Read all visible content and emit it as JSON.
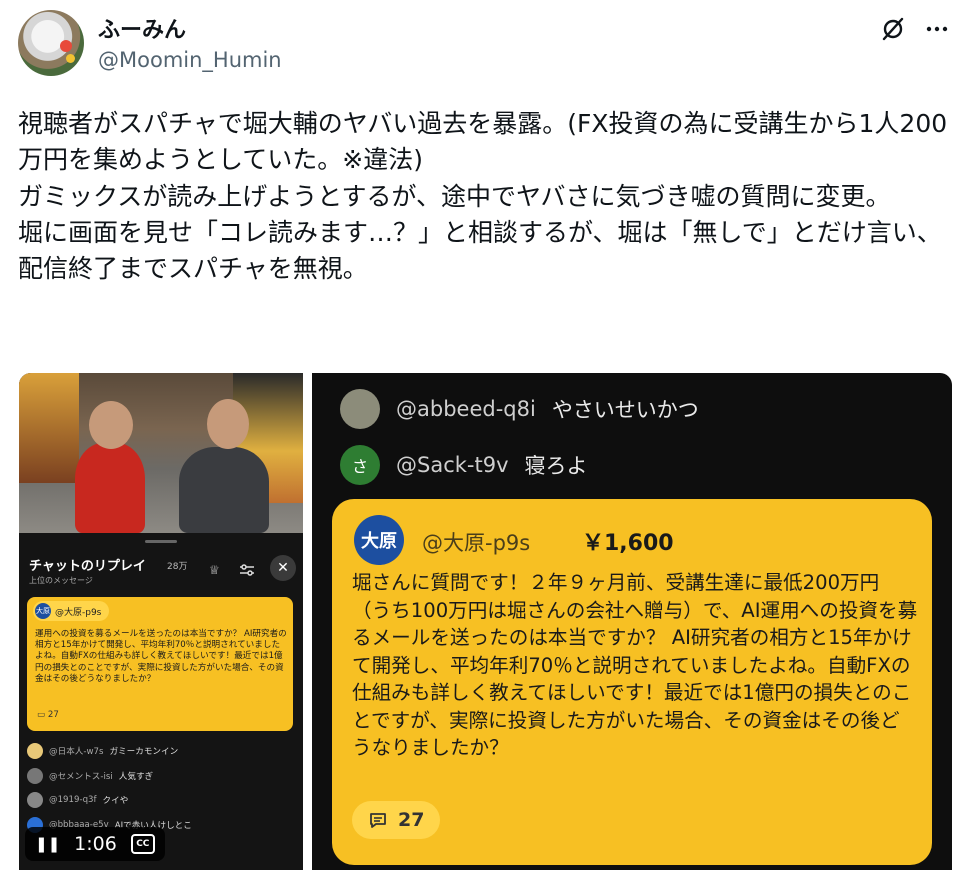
{
  "author": {
    "display_name": "ふーみん",
    "handle": "@Moomin_Humin"
  },
  "header": {
    "grok_icon": "grok-slash-icon",
    "more_icon": "more-dots-icon"
  },
  "tweet": {
    "text": "視聴者がスパチャで堀大輔のヤバい過去を暴露。(FX投資の為に受講生から1人200万円を集めようとしていた。※違法)\nガミックスが読み上げようとするが、途中でヤバさに気づき嘘の質問に変更。\n堀に画面を見せ「コレ読みます…？」と相談するが、堀は「無しで」とだけ言い、配信終了までスパチャを無視。"
  },
  "video": {
    "chat_panel": {
      "title": "チャットのリプレイ",
      "count": "28万",
      "subtitle": "上位のメッセージ",
      "superchat": {
        "avatar_text": "大原",
        "user": "@大原-p9s",
        "message": "運用への投資を募るメールを送ったのは本当ですか？ AI研究者の相方と15年かけて開発し、平均年利70％と説明されていましたよね。自動FXの仕組みも詳しく教えてほしいです！最近では1億円の損失とのことですが、実際に投資した方がいた場合、その資金はその後どうなりましたか？",
        "likes": "27"
      },
      "messages": [
        {
          "user": "@日本人-w7s",
          "text": "ガミーカモンイン",
          "color": "#e8c878"
        },
        {
          "user": "@セメントス-isi",
          "text": "人気すぎ",
          "color": "#777777"
        },
        {
          "user": "@1919-q3f",
          "text": "クイや",
          "color": "#888888"
        },
        {
          "user": "@bbbaaa-e5v",
          "text": "AIで赤い人けしとこ",
          "color": "#2a6fd6"
        },
        {
          "user": "",
          "text": "",
          "color": "#666666"
        }
      ]
    },
    "controls": {
      "time": "1:06",
      "cc_label": "CC"
    }
  },
  "zoomed": {
    "lines": [
      {
        "avatar_text": "",
        "user": "@abbeed-q8i",
        "text": "やさいせいかつ",
        "color": "#8c8c7a"
      },
      {
        "avatar_text": "さ",
        "user": "@Sack-t9v",
        "text": "寝ろよ",
        "color": "#2e7d32"
      }
    ],
    "superchat": {
      "avatar_text": "大原",
      "user": "@大原-p9s",
      "amount": "￥1,600",
      "message": "堀さんに質問です！２年９ヶ月前、受講生達に最低200万円（うち100万円は堀さんの会社へ贈与）で、AI運用への投資を募るメールを送ったのは本当ですか？ AI研究者の相方と15年かけて開発し、平均年利70％と説明されていましたよね。自動FXの仕組みも詳しく教えてほしいです！最近では1億円の損失とのことですが、実際に投資した方がいた場合、その資金はその後どうなりましたか？",
      "likes": "27"
    }
  }
}
